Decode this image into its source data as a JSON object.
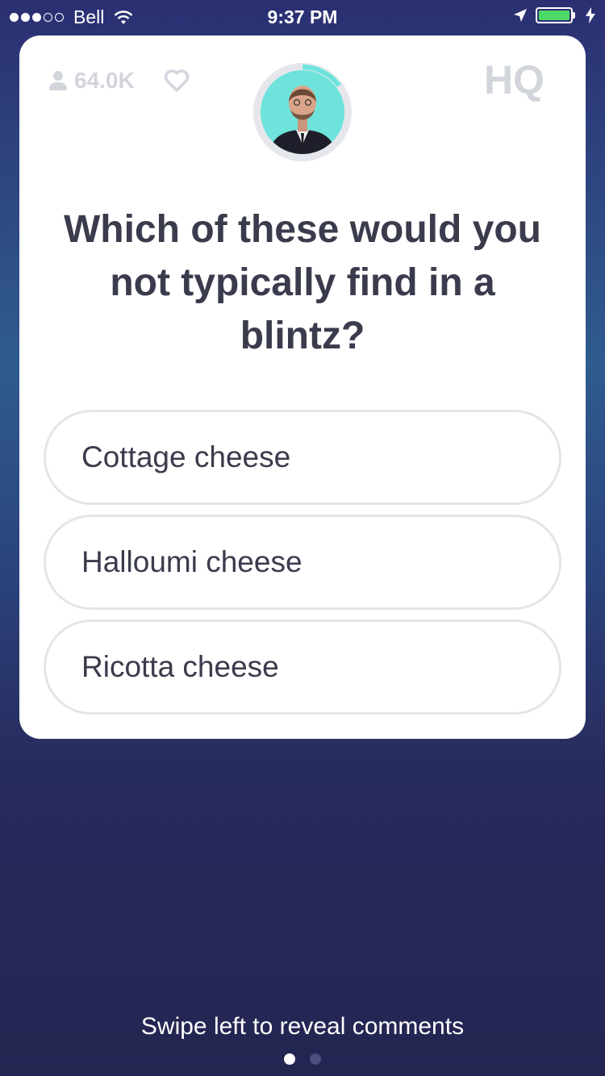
{
  "status_bar": {
    "carrier": "Bell",
    "time": "9:37 PM",
    "signal_bars_filled": 3,
    "signal_bars_total": 5,
    "battery_level": 1.0,
    "icons": [
      "wifi-icon",
      "location-arrow-icon",
      "battery-icon",
      "charging-bolt-icon"
    ]
  },
  "header": {
    "viewer_count": "64.0K",
    "logo": "HQ",
    "timer_progress": 0.15
  },
  "question": {
    "text": "Which of these would you not typically find in a blintz?"
  },
  "answers": [
    {
      "label": "Cottage cheese"
    },
    {
      "label": "Halloumi cheese"
    },
    {
      "label": "Ricotta cheese"
    }
  ],
  "footer": {
    "hint": "Swipe left to reveal comments",
    "page_count": 2,
    "current_page": 1
  },
  "colors": {
    "accent": "#6ee3dc",
    "text": "#3a3b4c",
    "muted": "#d3d5dd",
    "battery": "#4cd964"
  }
}
